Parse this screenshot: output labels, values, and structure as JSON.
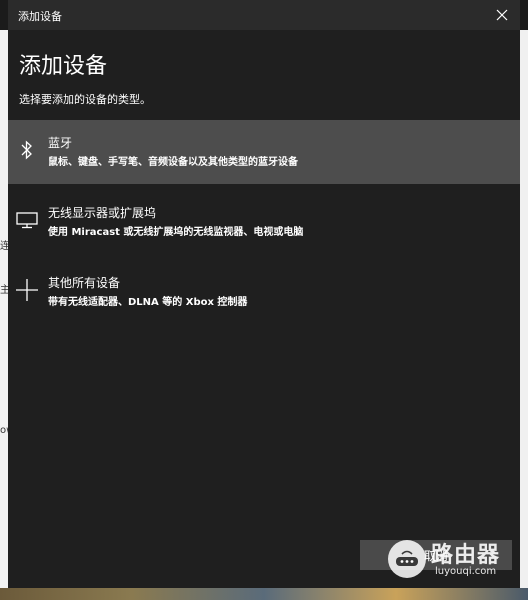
{
  "window": {
    "title": "添加设备"
  },
  "background": {
    "left_fragments": [
      "连",
      "主",
      "ow"
    ]
  },
  "dialog": {
    "heading": "添加设备",
    "subtitle": "选择要添加的设备的类型。",
    "options": [
      {
        "title": "蓝牙",
        "description": "鼠标、键盘、手写笔、音频设备以及其他类型的蓝牙设备",
        "icon": "bluetooth-icon",
        "selected": true
      },
      {
        "title": "无线显示器或扩展坞",
        "description": "使用 Miracast 或无线扩展坞的无线监视器、电视或电脑",
        "icon": "monitor-icon",
        "selected": false
      },
      {
        "title": "其他所有设备",
        "description": "带有无线适配器、DLNA 等的 Xbox 控制器",
        "icon": "plus-icon",
        "selected": false
      }
    ],
    "cancel_label": "取消"
  },
  "watermark": {
    "title": "路由器",
    "url": "luyouqi.com"
  },
  "colors": {
    "dialog_bg": "#1f1f1f",
    "titlebar_bg": "#2b2b2b",
    "selected_bg": "#4d4d4d",
    "text": "#ffffff"
  }
}
